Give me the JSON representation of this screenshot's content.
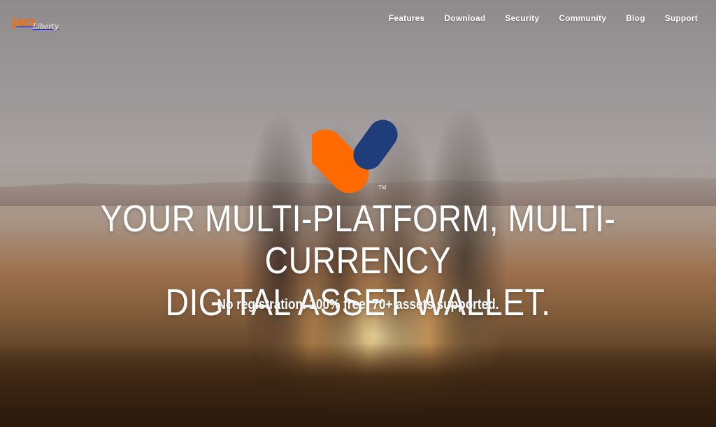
{
  "brand": {
    "logo_text": "jaxx",
    "logo_subtext": "Liberty",
    "accent_orange": "#ff6b00",
    "accent_navy": "#1f3d7a"
  },
  "nav": {
    "items": [
      {
        "label": "Features"
      },
      {
        "label": "Download"
      },
      {
        "label": "Security"
      },
      {
        "label": "Community"
      },
      {
        "label": "Blog"
      },
      {
        "label": "Support"
      }
    ]
  },
  "hero": {
    "trademark": "TM",
    "headline_line1": "YOUR MULTI-PLATFORM, MULTI-CURRENCY",
    "headline_line2": "DIGITAL ASSET WALLET.",
    "tagline": "No registration. 100% free. 70+ assets supported."
  }
}
